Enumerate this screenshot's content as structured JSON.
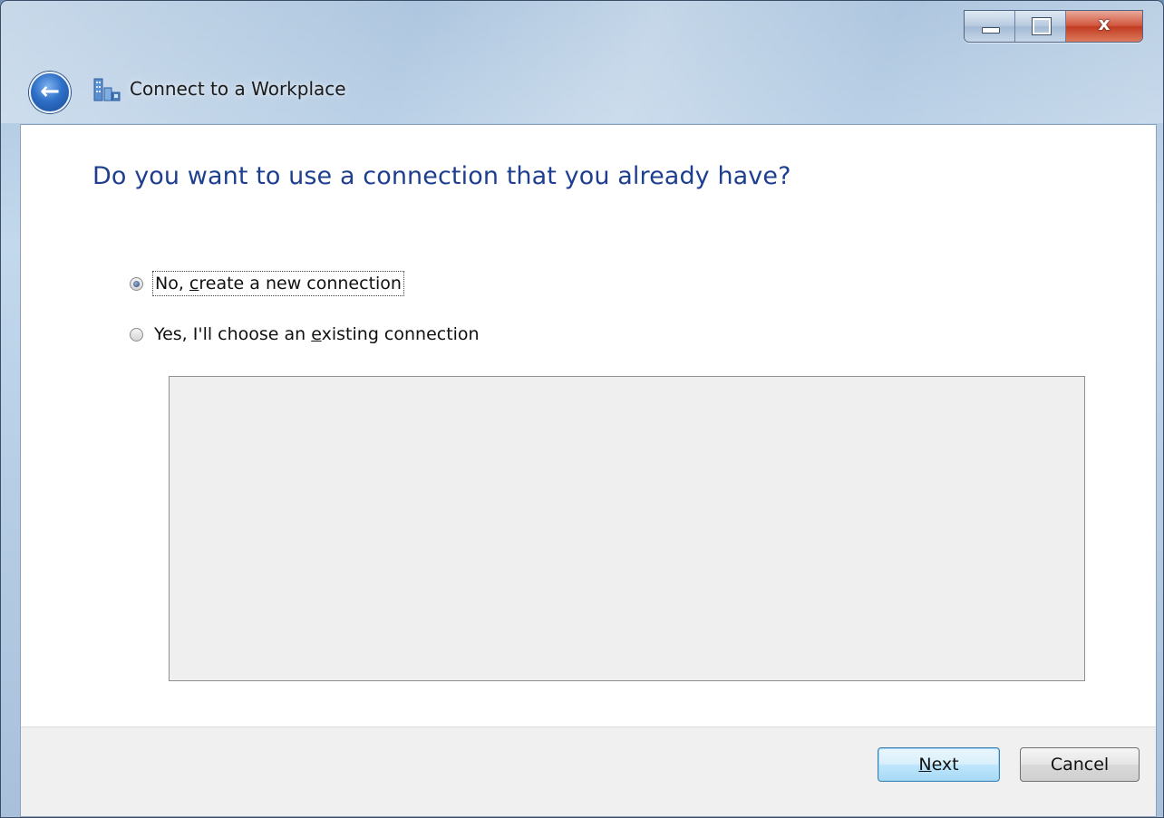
{
  "window": {
    "title": "Connect to a Workplace",
    "caption": {
      "minimize": "minimize-icon",
      "maximize": "maximize-icon",
      "close_glyph": "x"
    },
    "back_icon": "back-arrow-icon",
    "app_icon": "workplace-icon"
  },
  "main": {
    "heading": "Do you want to use a connection that you already have?",
    "options": [
      {
        "label_pre": "No, ",
        "accel": "c",
        "label_post": "reate a new connection",
        "checked": true
      },
      {
        "label_pre": "Yes, I'll choose an ",
        "accel": "e",
        "label_post": "xisting connection",
        "checked": false
      }
    ],
    "connections_list": []
  },
  "footer": {
    "next": {
      "accel": "N",
      "rest": "ext"
    },
    "cancel": "Cancel"
  },
  "colors": {
    "heading": "#1e3f8f",
    "close_button": "#c13b22",
    "default_button_border": "#3c7fb1"
  }
}
